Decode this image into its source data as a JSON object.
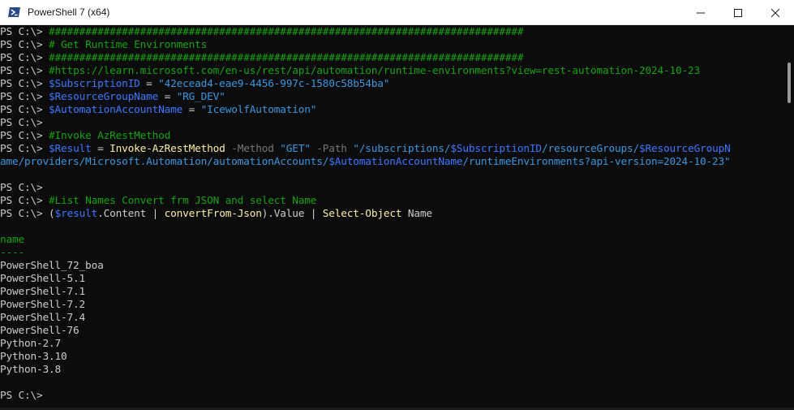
{
  "window": {
    "title": "PowerShell 7 (x64)",
    "app_icon": "powershell-icon"
  },
  "caption": {
    "minimize_icon": "minimize-icon",
    "maximize_icon": "maximize-icon",
    "close_icon": "close-icon"
  },
  "colors": {
    "background": "#0c0c0c",
    "prompt": "#cccccc",
    "comment": "#13a10e",
    "variable": "#3b78ff",
    "string": "#3a96dd",
    "command": "#f9f1a5",
    "parameter": "#767676"
  },
  "console": {
    "prompt": "PS C:\\> ",
    "l1": "##############################################################################",
    "l2": "# Get Runtime Environments",
    "l3": "##############################################################################",
    "l4": "#https://learn.microsoft.com/en-us/rest/api/automation/runtime-environments?view=rest-automation-2024-10-23",
    "l5_var": "$SubscriptionID",
    "l5_eq": " = ",
    "l5_val": "\"42ecead4-eae9-4456-997c-1580c58b54ba\"",
    "l6_var": "$ResourceGroupName",
    "l6_eq": " = ",
    "l6_val": "\"RG_DEV\"",
    "l7_var": "$AutomationAccountName",
    "l7_eq": " = ",
    "l7_val": "\"IcewolfAutomation\"",
    "l9": "#Invoke AzRestMethod",
    "l10_var": "$Result",
    "l10_eq": " = ",
    "l10_cmd": "Invoke-AzRestMethod",
    "l10_p1": " -Method ",
    "l10_v1": "\"GET\"",
    "l10_p2": " -Path ",
    "l10_s1": "\"/subscriptions/",
    "l10_v2": "$SubscriptionID",
    "l10_s2": "/resourceGroups/",
    "l10_v3": "$ResourceGroupN",
    "l11_s1": "ame/providers/Microsoft.Automation/automationAccounts/",
    "l11_v1": "$AutomationAccountName",
    "l11_s2": "/runtimeEnvironments?api-version=2024-10-23\"",
    "l13": "#List Names Convert frm JSON and select Name",
    "l14_a": "(",
    "l14_var": "$result",
    "l14_b": ".Content | ",
    "l14_cmd1": "convertFrom-Json",
    "l14_c": ").Value | ",
    "l14_cmd2": "Select-Object",
    "l14_d": " Name",
    "header": "name",
    "underline": "----",
    "output": [
      "PowerShell_72_boa",
      "PowerShell-5.1",
      "PowerShell-7.1",
      "PowerShell-7.2",
      "PowerShell-7.4",
      "PowerShell-76",
      "Python-2.7",
      "Python-3.10",
      "Python-3.8"
    ]
  }
}
